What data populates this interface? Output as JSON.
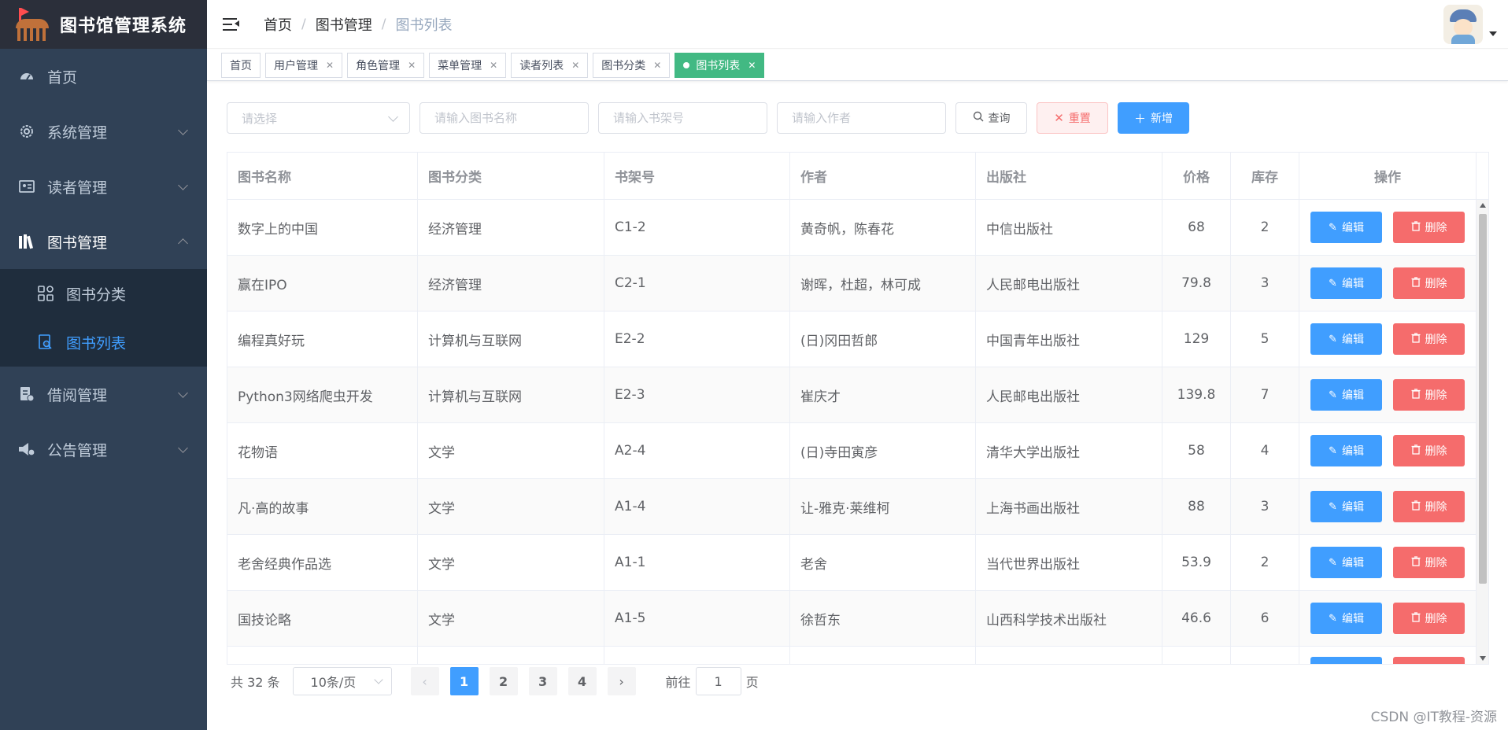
{
  "app": {
    "title": "图书馆管理系统"
  },
  "sidebar": {
    "items": [
      {
        "label": "首页"
      },
      {
        "label": "系统管理"
      },
      {
        "label": "读者管理"
      },
      {
        "label": "图书管理"
      },
      {
        "label": "借阅管理"
      },
      {
        "label": "公告管理"
      }
    ],
    "submenu": [
      {
        "label": "图书分类"
      },
      {
        "label": "图书列表"
      }
    ]
  },
  "breadcrumb": [
    "首页",
    "图书管理",
    "图书列表"
  ],
  "tabs": [
    {
      "label": "首页"
    },
    {
      "label": "用户管理"
    },
    {
      "label": "角色管理"
    },
    {
      "label": "菜单管理"
    },
    {
      "label": "读者列表"
    },
    {
      "label": "图书分类"
    },
    {
      "label": "图书列表"
    }
  ],
  "filters": {
    "category_placeholder": "请选择",
    "name_placeholder": "请输入图书名称",
    "shelf_placeholder": "请输入书架号",
    "author_placeholder": "请输入作者",
    "search_label": "查询",
    "reset_label": "重置",
    "add_label": "新增"
  },
  "table": {
    "headers": [
      "图书名称",
      "图书分类",
      "书架号",
      "作者",
      "出版社",
      "价格",
      "库存",
      "操作"
    ],
    "edit_label": "编辑",
    "delete_label": "删除",
    "rows": [
      [
        "数字上的中国",
        "经济管理",
        "C1-2",
        "黄奇帆，陈春花",
        "中信出版社",
        "68",
        "2"
      ],
      [
        "赢在IPO",
        "经济管理",
        "C2-1",
        "谢晖，杜超，林可成",
        "人民邮电出版社",
        "79.8",
        "3"
      ],
      [
        "编程真好玩",
        "计算机与互联网",
        "E2-2",
        "(日)冈田哲郎",
        "中国青年出版社",
        "129",
        "5"
      ],
      [
        "Python3网络爬虫开发",
        "计算机与互联网",
        "E2-3",
        "崔庆才",
        "人民邮电出版社",
        "139.8",
        "7"
      ],
      [
        "花物语",
        "文学",
        "A2-4",
        "(日)寺田寅彦",
        "清华大学出版社",
        "58",
        "4"
      ],
      [
        "凡·高的故事",
        "文学",
        "A1-4",
        "让-雅克·莱维柯",
        "上海书画出版社",
        "88",
        "3"
      ],
      [
        "老舍经典作品选",
        "文学",
        "A1-1",
        "老舍",
        "当代世界出版社",
        "53.9",
        "2"
      ],
      [
        "国技论略",
        "文学",
        "A1-5",
        "徐哲东",
        "山西科学技术出版社",
        "46.6",
        "6"
      ]
    ]
  },
  "pagination": {
    "total_text": "共 32 条",
    "page_size": "10条/页",
    "pages": [
      "1",
      "2",
      "3",
      "4"
    ],
    "current": "1",
    "goto_prefix": "前往",
    "goto_value": "1",
    "goto_suffix": "页"
  },
  "watermark": "CSDN @IT教程-资源"
}
